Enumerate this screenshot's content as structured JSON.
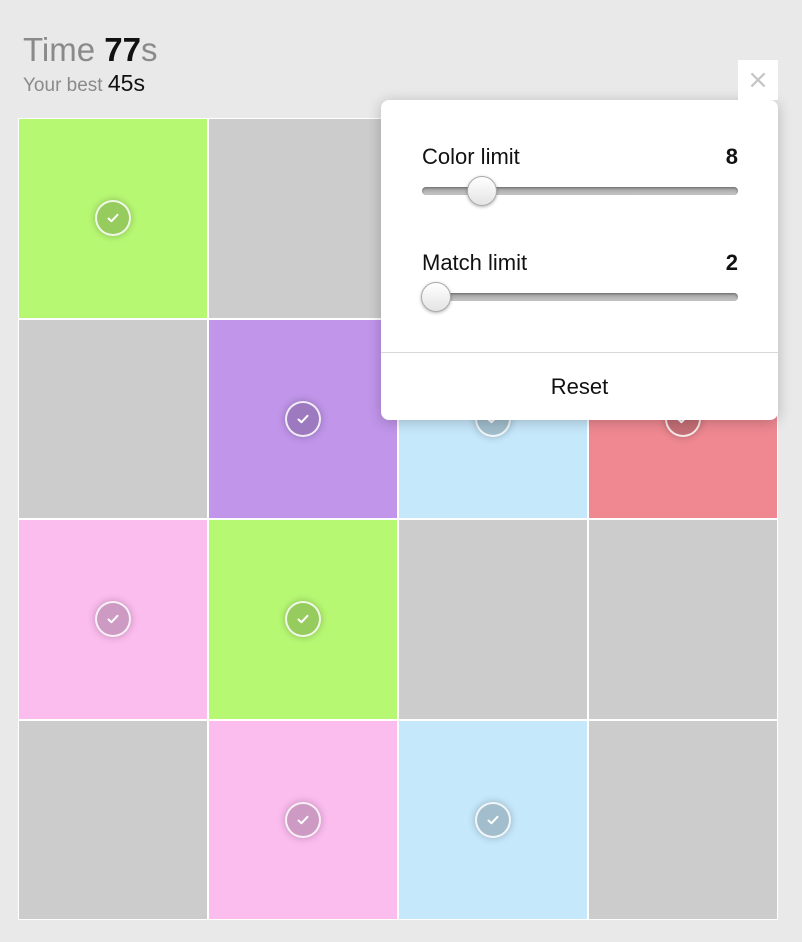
{
  "header": {
    "time_label": "Time",
    "time_value": "77",
    "time_unit": "s",
    "best_label": "Your best",
    "best_value": "45s"
  },
  "close": {
    "label": "×"
  },
  "settings": {
    "color_limit": {
      "label": "Color limit",
      "value": "8",
      "fraction": 0.16
    },
    "match_limit": {
      "label": "Match limit",
      "value": "2",
      "fraction": 0.0
    },
    "reset_label": "Reset"
  },
  "board": {
    "rows": 4,
    "cols": 4,
    "colors": {
      "empty": "#cccccc",
      "green": "#b7f873",
      "purple": "#c095ea",
      "blue": "#c6e8fb",
      "red": "#ef8891",
      "pink": "#fbbcee"
    },
    "tiles": [
      [
        "green",
        "empty",
        "empty",
        "empty"
      ],
      [
        "empty",
        "purple",
        "blue",
        "red"
      ],
      [
        "pink",
        "green",
        "empty",
        "empty"
      ],
      [
        "empty",
        "pink",
        "blue",
        "empty"
      ]
    ],
    "matched": [
      [
        true,
        false,
        false,
        false
      ],
      [
        false,
        true,
        true,
        true
      ],
      [
        true,
        true,
        false,
        false
      ],
      [
        false,
        true,
        true,
        false
      ]
    ]
  },
  "icons": {
    "check": "check-icon",
    "close": "close-icon"
  }
}
